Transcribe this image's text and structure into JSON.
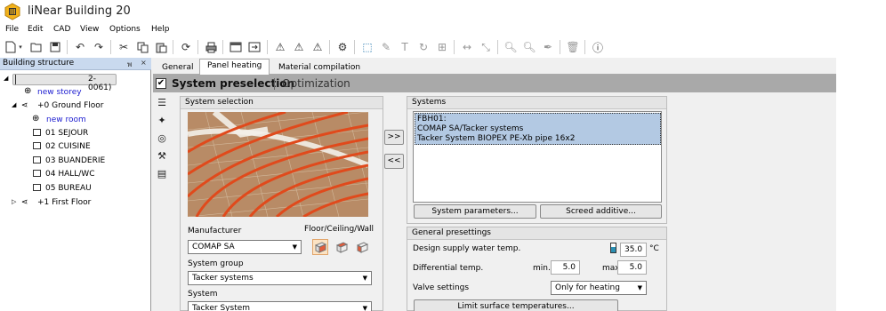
{
  "app": {
    "title": "liNear Building 20"
  },
  "menu": [
    "File",
    "Edit",
    "CAD",
    "View",
    "Options",
    "Help"
  ],
  "toolbar_icons": [
    "new-icon",
    "open-icon",
    "save-icon",
    "undo-icon",
    "redo-icon",
    "cut-icon",
    "copy-icon",
    "paste-icon",
    "refresh-icon",
    "print-icon",
    "window-icon",
    "import-icon",
    "warning-icon",
    "warning-list-icon",
    "warning-table-icon",
    "settings-icon",
    "select-icon",
    "pencil-icon",
    "text-icon",
    "rotate-icon",
    "group-icon",
    "dimension-icon",
    "scale-icon",
    "zoom-out-icon",
    "zoom-in-icon",
    "eyedropper-icon",
    "delete-icon",
    "info-icon"
  ],
  "left_panel": {
    "title": "Building structure",
    "pin": "พ",
    "close": "×",
    "tree": [
      {
        "label": "2-0061)",
        "level": 0,
        "type": "root"
      },
      {
        "label": "new storey",
        "level": 1,
        "type": "new"
      },
      {
        "label": "+0  Ground Floor",
        "level": 1,
        "type": "floor"
      },
      {
        "label": "new room",
        "level": 2,
        "type": "new"
      },
      {
        "label": "01 SEJOUR",
        "level": 2,
        "type": "room"
      },
      {
        "label": "02 CUISINE",
        "level": 2,
        "type": "room"
      },
      {
        "label": "03 BUANDERIE",
        "level": 2,
        "type": "room"
      },
      {
        "label": "04 HALL/WC",
        "level": 2,
        "type": "room"
      },
      {
        "label": "05 BUREAU",
        "level": 2,
        "type": "room"
      },
      {
        "label": "+1  First Floor",
        "level": 1,
        "type": "floor"
      }
    ]
  },
  "tabs": [
    "General",
    "Panel heating",
    "Material compilation"
  ],
  "active_tab": "Panel heating",
  "section": {
    "title": "System preselection",
    "other": "Optimization"
  },
  "system_selection": {
    "title": "System selection",
    "manufacturer_label": "Manufacturer",
    "manufacturer_value": "COMAP SA",
    "fcw_label": "Floor/Ceiling/Wall",
    "system_group_label": "System group",
    "system_group_value": "Tacker systems",
    "system_label": "System",
    "system_value": "Tacker System"
  },
  "transfer": {
    "add": ">>",
    "remove": "<<"
  },
  "systems": {
    "title": "Systems",
    "selected": [
      "FBH01:",
      "COMAP SA/Tacker systems",
      "Tacker System BIOPEX PE-Xb pipe 16x2"
    ],
    "params_button": "System parameters...",
    "screed_button": "Screed additive..."
  },
  "presettings": {
    "title": "General presettings",
    "supply_label": "Design supply water temp.",
    "supply_value": "35.0",
    "supply_unit": "°C",
    "diff_label": "Differential temp.",
    "min_label": "min.",
    "min_value": "5.0",
    "max_label": "max",
    "max_value": "5.0",
    "valve_label": "Valve settings",
    "valve_value": "Only for heating",
    "limit_button": "Limit surface temperatures..."
  },
  "colors": {
    "selection": "#b3c9e3",
    "header": "#a9a9a9",
    "pipe": "#e04a1c"
  }
}
